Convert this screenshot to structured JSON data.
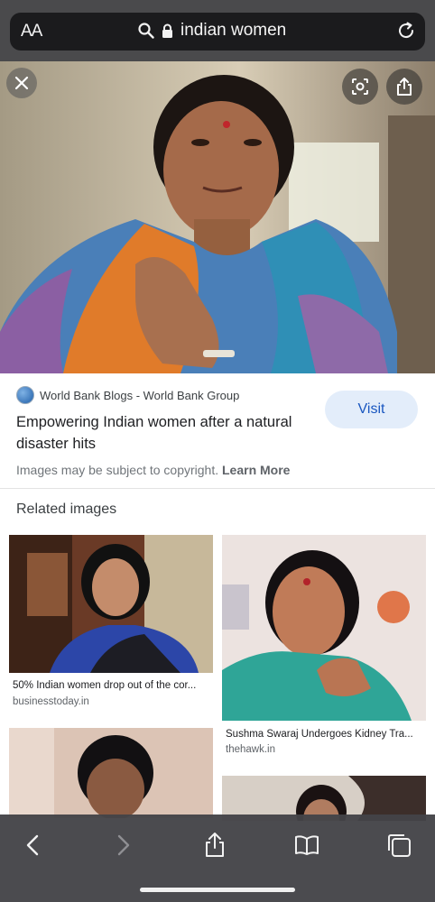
{
  "address_bar": {
    "text_size_label": "AA",
    "url_text": "indian women",
    "icons": [
      "search-icon",
      "lock-icon",
      "reload-icon"
    ]
  },
  "preview": {
    "source_name": "World Bank Blogs - World Bank Group",
    "title": "Empowering Indian women after a natural disaster hits",
    "visit_label": "Visit",
    "copyright_text": "Images may be subject to copyright.",
    "learn_more_label": "Learn More",
    "icons": [
      "close-icon",
      "lens-icon",
      "share-icon",
      "globe-icon"
    ]
  },
  "related": {
    "heading": "Related images",
    "items": [
      {
        "caption": "50% Indian women drop out of the cor...",
        "domain": "businesstoday.in"
      },
      {
        "caption": "Sushma Swaraj Undergoes Kidney Tra...",
        "domain": "thehawk.in"
      }
    ]
  },
  "toolbar": {
    "icons": [
      "back-icon",
      "forward-icon",
      "share-icon",
      "bookmarks-icon",
      "tabs-icon"
    ]
  }
}
